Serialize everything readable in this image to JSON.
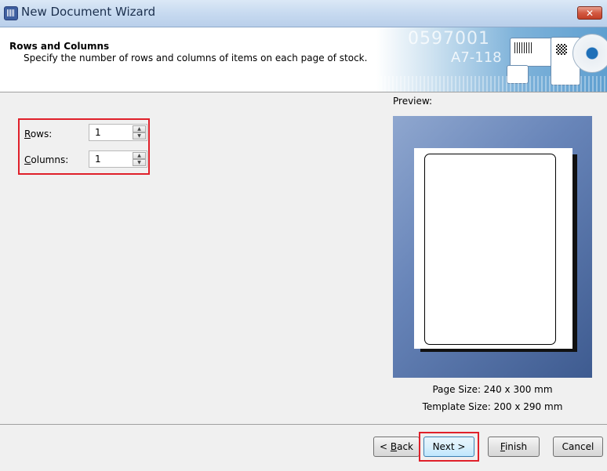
{
  "window": {
    "title": "New Document Wizard",
    "close_glyph": "✕"
  },
  "header": {
    "title": "Rows and Columns",
    "subtitle": "Specify the number of rows and columns of items on each page of stock.",
    "banner_text_1": "0597001",
    "banner_text_2": "A7-118"
  },
  "form": {
    "rows": {
      "label_mnemonic": "R",
      "label_rest": "ows:",
      "value": "1"
    },
    "columns": {
      "label_mnemonic": "C",
      "label_rest": "olumns:",
      "value": "1"
    },
    "spin_up_glyph": "▲",
    "spin_down_glyph": "▼"
  },
  "preview": {
    "label": "Preview:",
    "page_size": "Page Size:  240 x 300 mm",
    "template_size": "Template Size:  200 x 290 mm"
  },
  "buttons": {
    "back": {
      "prefix": "< ",
      "mnemonic": "B",
      "rest": "ack"
    },
    "next": "Next >",
    "finish": {
      "mnemonic": "F",
      "rest": "inish"
    },
    "cancel": "Cancel"
  },
  "colors": {
    "highlight": "#e0202a",
    "preview_bg": "#5a77ab"
  }
}
